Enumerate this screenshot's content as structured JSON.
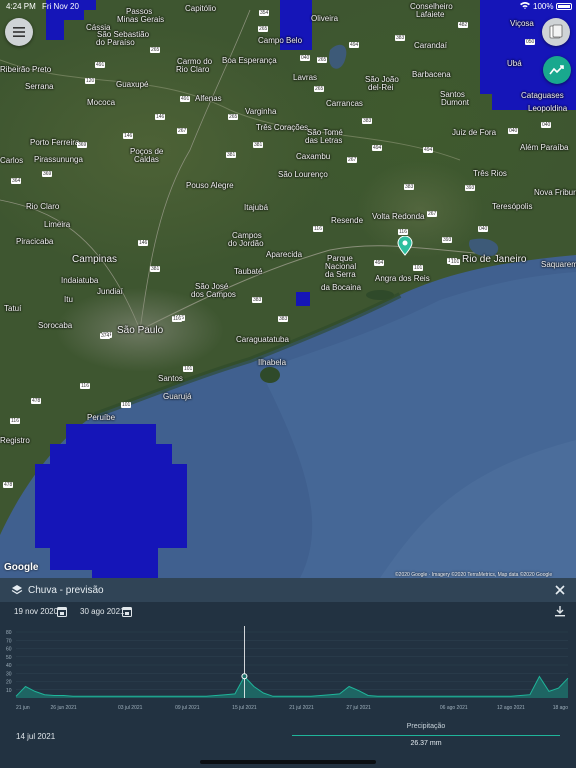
{
  "status_bar": {
    "time": "4:24 PM",
    "date": "Fri Nov 20",
    "battery": "100%"
  },
  "map": {
    "cities": [
      {
        "name": "Capitólio"
      },
      {
        "name": "Passos"
      },
      {
        "name": "Minas Gerais"
      },
      {
        "name": "São Sebastião"
      },
      {
        "name": "do Paraíso"
      },
      {
        "name": "Oliveira"
      },
      {
        "name": "Conselheiro"
      },
      {
        "name": "Lafaiete"
      },
      {
        "name": "Viçosa"
      },
      {
        "name": "Cássia"
      },
      {
        "name": "Campo Belo"
      },
      {
        "name": "Carandaí"
      },
      {
        "name": "Ubá"
      },
      {
        "name": "Barbacena"
      },
      {
        "name": "Cataguases"
      },
      {
        "name": "Lavras"
      },
      {
        "name": "São João"
      },
      {
        "name": "del-Rei"
      },
      {
        "name": "Santos"
      },
      {
        "name": "Dumont"
      },
      {
        "name": "Leopoldina"
      },
      {
        "name": "Boa Esperança"
      },
      {
        "name": "Carmo do"
      },
      {
        "name": "Rio Claro"
      },
      {
        "name": "Ribeirão Preto"
      },
      {
        "name": "Guaxupé"
      },
      {
        "name": "Serrana"
      },
      {
        "name": "Alfenas"
      },
      {
        "name": "Mococa"
      },
      {
        "name": "Varginha"
      },
      {
        "name": "Três Corações"
      },
      {
        "name": "Carrancas"
      },
      {
        "name": "São Tomé"
      },
      {
        "name": "das Letras"
      },
      {
        "name": "Juiz de Fora"
      },
      {
        "name": "Além Paraíba"
      },
      {
        "name": "Porto Ferreira"
      },
      {
        "name": "Pirassununga"
      },
      {
        "name": "Poços de"
      },
      {
        "name": "Caldas"
      },
      {
        "name": "Caxambu"
      },
      {
        "name": "São Lourenço"
      },
      {
        "name": "Três Rios"
      },
      {
        "name": "Carlos"
      },
      {
        "name": "Pouso Alegre"
      },
      {
        "name": "Itajubá"
      },
      {
        "name": "Resende"
      },
      {
        "name": "Volta Redonda"
      },
      {
        "name": "Teresópolis"
      },
      {
        "name": "Nova Friburgo"
      },
      {
        "name": "Rio Claro"
      },
      {
        "name": "Limeira"
      },
      {
        "name": "Piracicaba"
      },
      {
        "name": "Campos"
      },
      {
        "name": "do Jordão"
      },
      {
        "name": "Parque"
      },
      {
        "name": "Nacional"
      },
      {
        "name": "da Serra"
      },
      {
        "name": "da Bocaina"
      },
      {
        "name": "Rio de Janeiro"
      },
      {
        "name": "Saquarema"
      },
      {
        "name": "Campinas"
      },
      {
        "name": "Aparecida"
      },
      {
        "name": "Indaiatuba"
      },
      {
        "name": "Jundiaí"
      },
      {
        "name": "Taubaté"
      },
      {
        "name": "São José"
      },
      {
        "name": "dos Campos"
      },
      {
        "name": "Angra dos Reis"
      },
      {
        "name": "Itu"
      },
      {
        "name": "Tatuí"
      },
      {
        "name": "Sorocaba"
      },
      {
        "name": "São Paulo"
      },
      {
        "name": "Caraguatatuba"
      },
      {
        "name": "Ilhabela"
      },
      {
        "name": "Santos"
      },
      {
        "name": "Guarujá"
      },
      {
        "name": "Peruíbe"
      },
      {
        "name": "Registro"
      }
    ],
    "roads": [
      "354",
      "265",
      "040",
      "482",
      "050",
      "265",
      "265",
      "494",
      "383",
      "265",
      "120",
      "491",
      "146",
      "491",
      "265",
      "494",
      "040",
      "267",
      "383",
      "146",
      "381",
      "369",
      "494",
      "267",
      "040",
      "383",
      "364",
      "393",
      "369",
      "040",
      "267",
      "381",
      "116",
      "393",
      "101",
      "116",
      "374",
      "116",
      "101",
      "116",
      "478",
      "478",
      "116",
      "101",
      "101",
      "383",
      "101",
      "494",
      "146",
      "374",
      "381",
      "116",
      "383"
    ],
    "credit": "©2020 Google · Imagery ©2020 TerraMetrics, Map data ©2020 Google",
    "google_logo": "Google"
  },
  "panel": {
    "title": "Chuva - previsão",
    "date_start": "19 nov 2020",
    "date_end": "30 ago 2021",
    "selected_date": "14 jul 2021",
    "metric_label": "Precipitação",
    "metric_value": "26.37 mm"
  },
  "chart_data": {
    "type": "area",
    "title": "",
    "xlabel": "",
    "ylabel": "",
    "ylim": [
      0,
      80
    ],
    "y_ticks": [
      "80",
      "70",
      "60",
      "50",
      "40",
      "30",
      "20",
      "10"
    ],
    "x_ticks": [
      "21 jun",
      "26 jun 2021",
      "03 jul 2021",
      "09 jul 2021",
      "15 jul 2021",
      "21 jul 2021",
      "27 jul 2021",
      "06 ago 2021",
      "12 ago 2021",
      "18 ago"
    ],
    "x_tick_positions": [
      0,
      5,
      12,
      18,
      24,
      30,
      36,
      46,
      52,
      58
    ],
    "series": [
      {
        "values": [
          2,
          14,
          8,
          4,
          3,
          3,
          2,
          2,
          2,
          2,
          2,
          2,
          2,
          2,
          2,
          2,
          2,
          2,
          2,
          2,
          2,
          3,
          4,
          5,
          26,
          14,
          6,
          2,
          2,
          2,
          2,
          2,
          3,
          4,
          5,
          14,
          9,
          3,
          2,
          2,
          2,
          2,
          2,
          2,
          2,
          2,
          2,
          2,
          2,
          2,
          2,
          2,
          2,
          3,
          4,
          26,
          8,
          12,
          24
        ]
      }
    ],
    "selected_index": 24,
    "selected_value": 26.37,
    "colors": {
      "line": "#1fb59a",
      "fill": "#1d6f6a",
      "cursor": "#ffffff"
    }
  },
  "colors": {
    "accent": "#19a88e",
    "rain_overlay": "#1515b8",
    "panel": "#223241",
    "panel_header": "#304456"
  }
}
